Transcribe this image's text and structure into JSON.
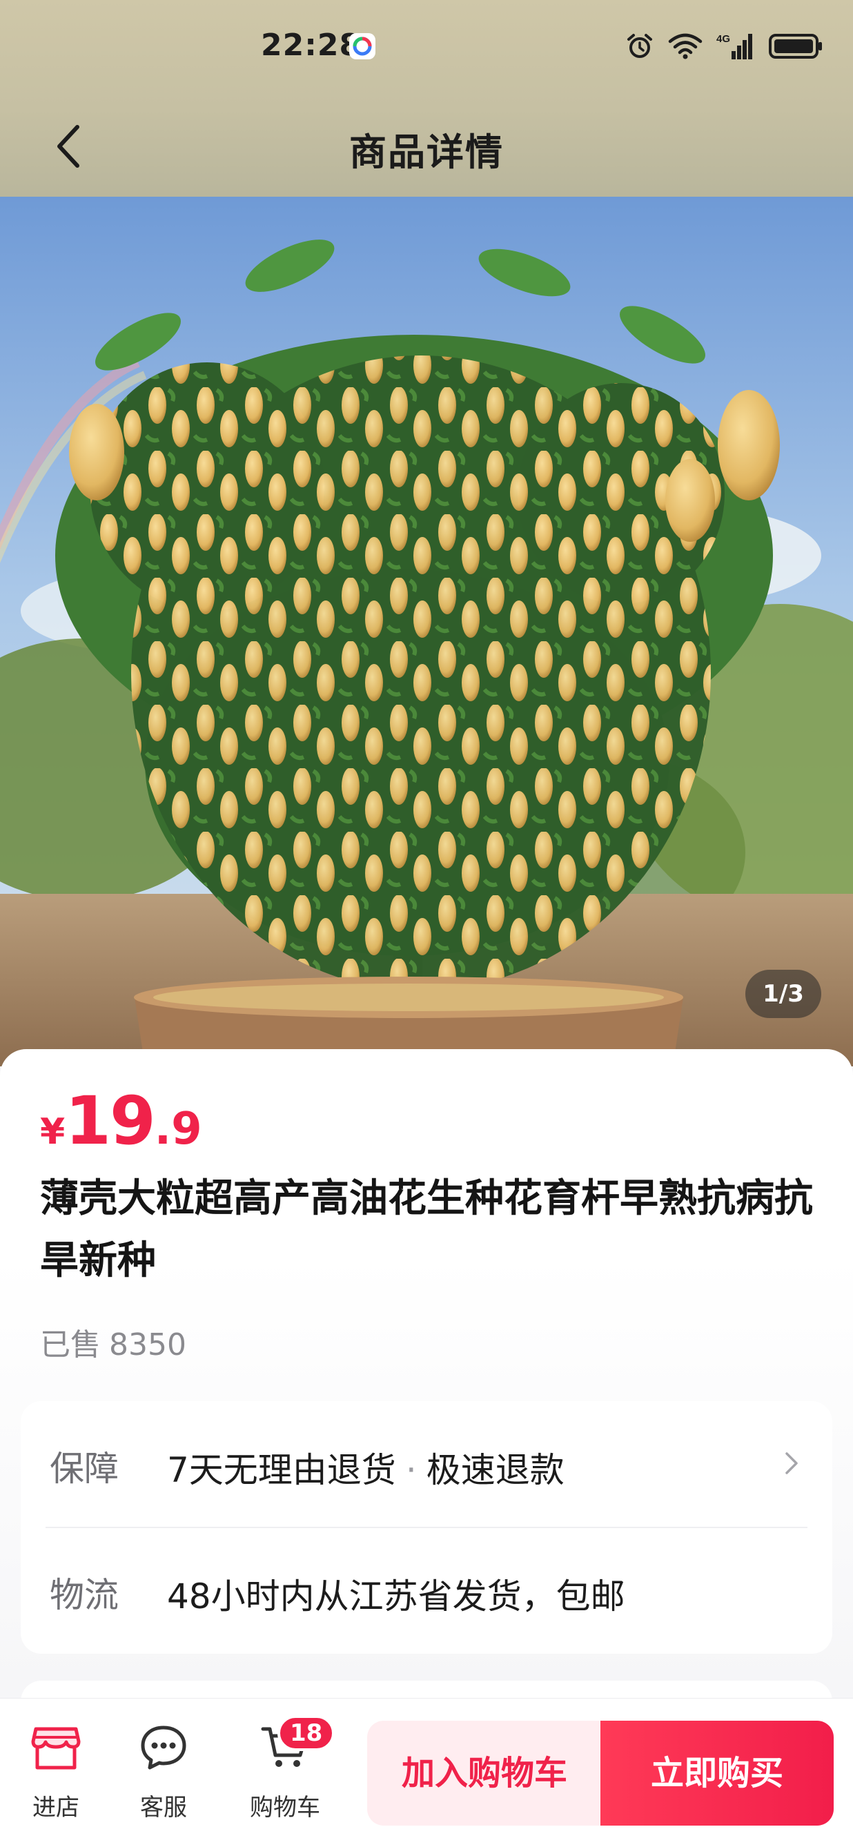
{
  "status_bar": {
    "time": "22:28",
    "network": "4G"
  },
  "nav": {
    "title": "商品详情"
  },
  "gallery": {
    "counter": "1/3"
  },
  "product": {
    "price_symbol": "¥",
    "price_integer": "19",
    "price_decimal": ".9",
    "title": "薄壳大粒超高产高油花生种花育杆早熟抗病抗旱新种",
    "sold_label": "已售",
    "sold_count": "8350"
  },
  "services": {
    "guarantee_label": "保障",
    "guarantee_part1": "7天无理由退货",
    "guarantee_sep": "·",
    "guarantee_part2": "极速退款",
    "logistics_label": "物流",
    "logistics_value": "48小时内从江苏省发货，包邮"
  },
  "bottom_bar": {
    "store_label": "进店",
    "service_label": "客服",
    "cart_label": "购物车",
    "cart_count": "18",
    "add_to_cart": "加入购物车",
    "buy_now": "立即购买"
  },
  "colors": {
    "accent": "#f0224a",
    "accent_light": "#ffedf0"
  }
}
